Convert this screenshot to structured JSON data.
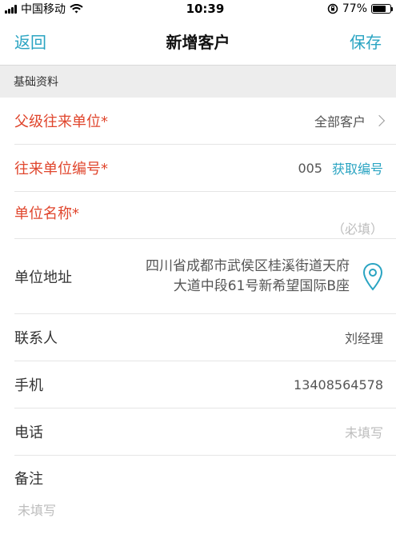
{
  "status": {
    "carrier": "中国移动",
    "time": "10:39",
    "battery": "77%",
    "battery_level": 0.77
  },
  "nav": {
    "back": "返回",
    "title": "新增客户",
    "save": "保存"
  },
  "section": {
    "basic": "基础资料"
  },
  "form": {
    "parent_unit": {
      "label": "父级往来单位*",
      "value": "全部客户"
    },
    "unit_code": {
      "label": "往来单位编号*",
      "value": "005",
      "action": "获取编号"
    },
    "unit_name": {
      "label": "单位名称*",
      "placeholder": "（必填）"
    },
    "address": {
      "label": "单位地址",
      "line1": "四川省成都市武侯区桂溪街道天府",
      "line2": "大道中段61号新希望国际B座"
    },
    "contact": {
      "label": "联系人",
      "value": "刘经理"
    },
    "mobile": {
      "label": "手机",
      "value": "13408564578"
    },
    "phone": {
      "label": "电话",
      "placeholder": "未填写"
    },
    "remark": {
      "label": "备注",
      "placeholder": "未填写"
    }
  },
  "colors": {
    "accent": "#2aa4c2",
    "required": "#e0462d"
  }
}
